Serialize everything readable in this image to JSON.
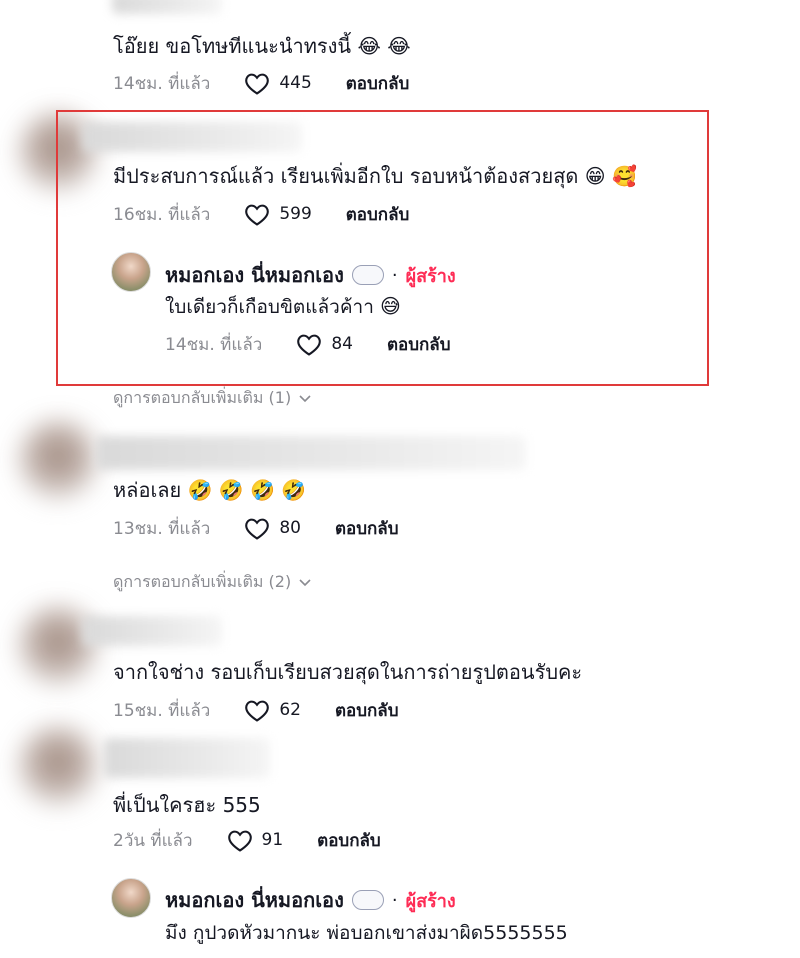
{
  "comments": [
    {
      "text": "โอ๊ยย ขอโทษทีแนะนำทรงนี้",
      "emoji": "😂 😂",
      "time": "14ชม. ที่แล้ว",
      "likes": "445",
      "reply": "ตอบกลับ"
    },
    {
      "text": "มีประสบการณ์แล้ว เรียนเพิ่มอีกใบ รอบหน้าต้องสวยสุด",
      "emoji": "😁 🥰",
      "time": "16ชม. ที่แล้ว",
      "likes": "599",
      "reply": "ตอบกลับ"
    },
    {
      "text": "หล่อเลย",
      "emoji": "🤣 🤣 🤣 🤣",
      "time": "13ชม. ที่แล้ว",
      "likes": "80",
      "reply": "ตอบกลับ"
    },
    {
      "text": "จากใจช่าง รอบเก็บเรียบสวยสุดในการถ่ายรูปตอนรับคะ",
      "time": "15ชม. ที่แล้ว",
      "likes": "62",
      "reply": "ตอบกลับ"
    },
    {
      "text": "พี่เป็นใครฮะ 555",
      "time": "2วัน ที่แล้ว",
      "likes": "91",
      "reply": "ตอบกลับ"
    }
  ],
  "creator_reply_1": {
    "name": "หมอกเอง นี่หมอกเอง",
    "badge": "ผู้สร้าง",
    "dot": "·",
    "text": "ใบเดียวก็เกือบขิตแล้วค้าา",
    "emoji": "😅",
    "time": "14ชม. ที่แล้ว",
    "likes": "84",
    "reply": "ตอบกลับ"
  },
  "creator_reply_2": {
    "name": "หมอกเอง นี่หมอกเอง",
    "badge": "ผู้สร้าง",
    "dot": "·",
    "text": "มึง กูปวดหัวมากนะ พ่อบอกเขาส่งมาผิด5555555"
  },
  "view_more": [
    "ดูการตอบกลับเพิ่มเติม (1)",
    "ดูการตอบกลับเพิ่มเติม (2)"
  ],
  "colors": {
    "creator_badge": "#fe2c55",
    "muted": "#8a8b91",
    "highlight_box": "#e03a3a"
  }
}
